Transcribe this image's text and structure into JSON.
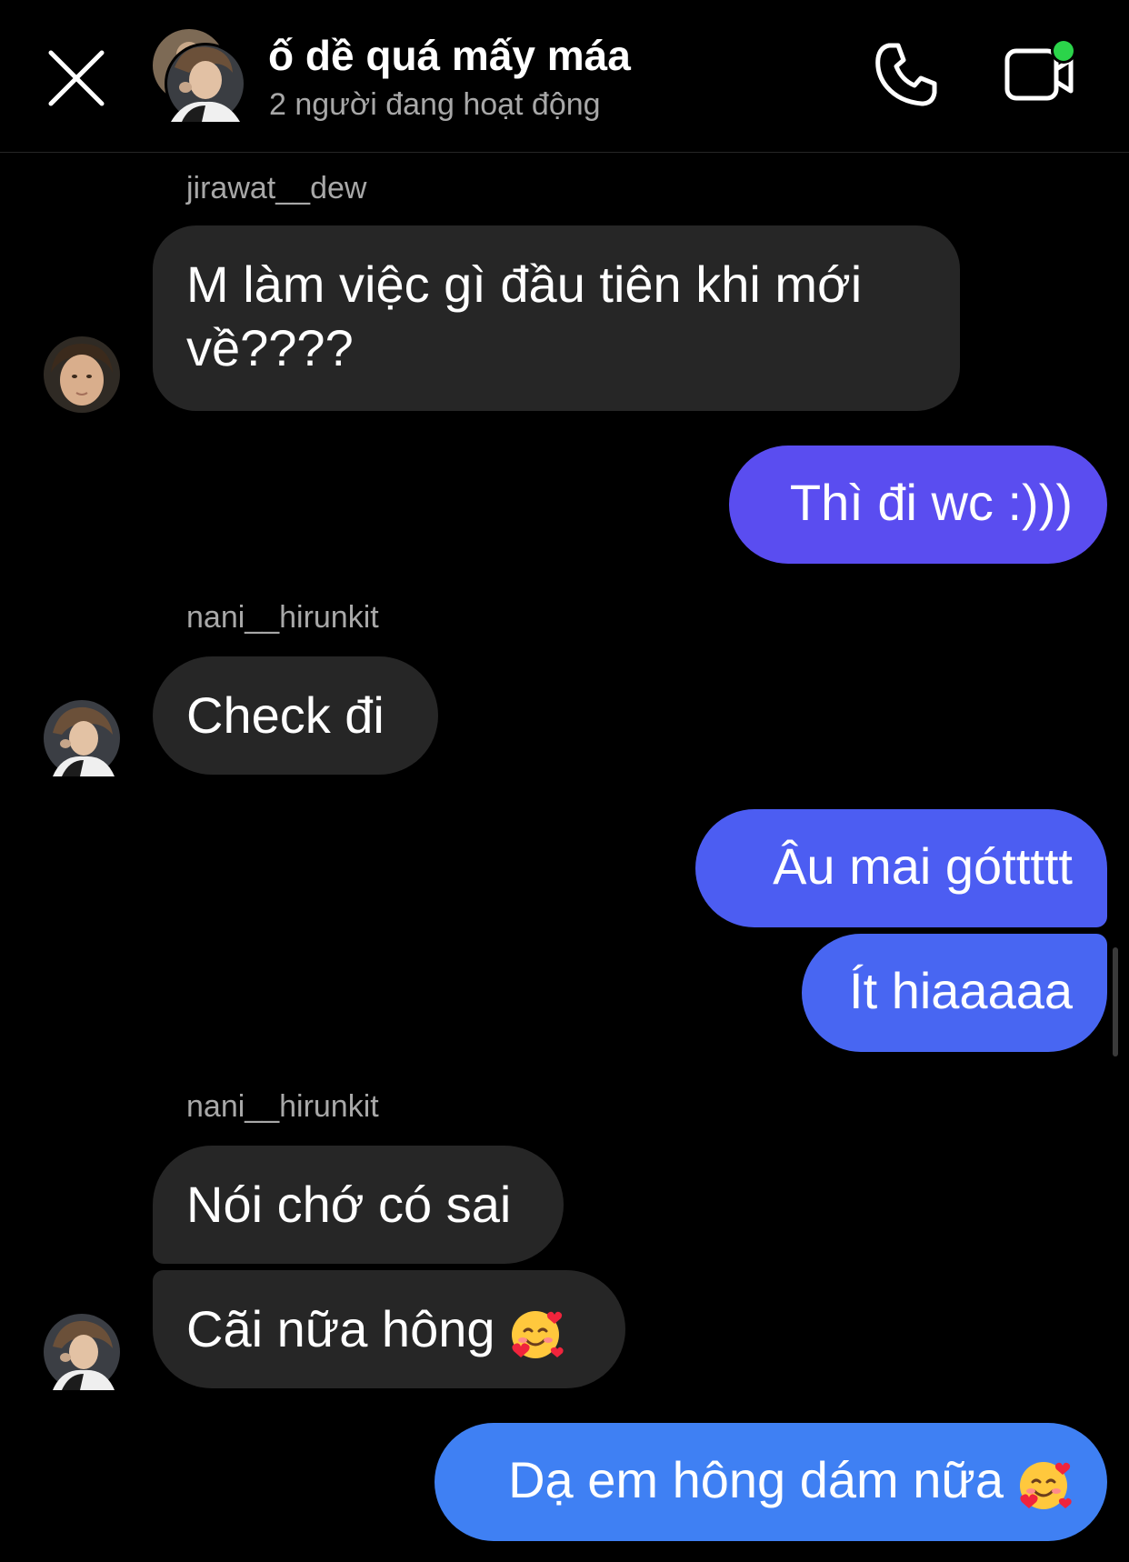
{
  "header": {
    "title": "ố dề quá mấy máa",
    "status": "2 người đang hoạt động",
    "close_icon": "close-icon",
    "call_icon": "phone-icon",
    "video_icon": "video-camera-icon",
    "active_dot_color": "#2bd44a"
  },
  "colors": {
    "incoming_bubble": "#262626",
    "outgoing_gradient_top": "#6a40ee",
    "outgoing_gradient_bottom": "#3f80f3"
  },
  "messages": [
    {
      "sender": "jirawat__dew",
      "direction": "in",
      "text_line1": "M làm việc gì đầu tiên khi mới",
      "text_line2": "về????"
    },
    {
      "direction": "out",
      "text": "Thì đi wc :)))"
    },
    {
      "sender": "nani__hirunkit",
      "direction": "in",
      "text": "Check đi"
    },
    {
      "direction": "out",
      "text": "Âu mai góttttt"
    },
    {
      "direction": "out",
      "text": "Ít hiaaaaa"
    },
    {
      "sender": "nani__hirunkit",
      "direction": "in",
      "text": "Nói chớ có sai"
    },
    {
      "direction": "in",
      "text": "Cãi nữa hông",
      "emoji": "smiling-face-with-hearts"
    },
    {
      "direction": "out",
      "text": "Dạ em hông dám nữa",
      "emoji": "smiling-face-with-hearts"
    }
  ]
}
